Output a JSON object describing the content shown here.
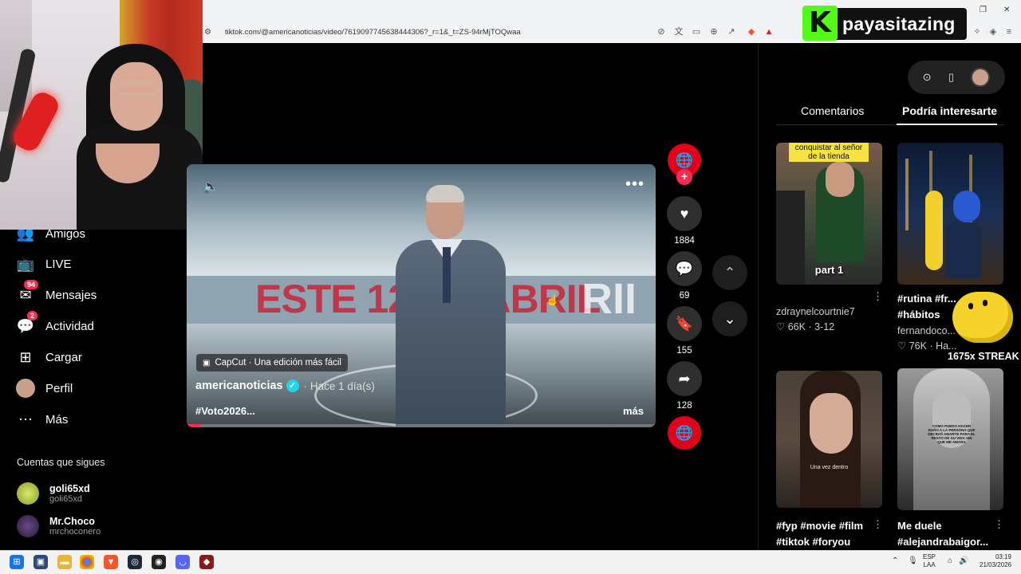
{
  "browser": {
    "url": "tiktok.com/@americanoticias/video/7619097745638444306?_r=1&_t=ZS-94rMjTOQwaa",
    "window_controls": [
      "–",
      "❐",
      "✕"
    ]
  },
  "streamer": {
    "logo_letter": "K",
    "name": "payasitazing",
    "brand_color": "#53fc18"
  },
  "sidebar": {
    "items": [
      {
        "label": "Amigos",
        "icon": "friends-icon"
      },
      {
        "label": "LIVE",
        "icon": "live-icon"
      },
      {
        "label": "Mensajes",
        "icon": "messages-icon",
        "badge": "94"
      },
      {
        "label": "Actividad",
        "icon": "activity-icon",
        "badge": "2"
      },
      {
        "label": "Cargar",
        "icon": "upload-icon"
      },
      {
        "label": "Perfil",
        "icon": "avatar"
      },
      {
        "label": "Más",
        "icon": "more-icon"
      }
    ],
    "following_title": "Cuentas que sigues",
    "following": [
      {
        "name": "goli65xd",
        "handle": "goli65xd"
      },
      {
        "name": "Mr.Choco",
        "handle": "mrchoconero"
      }
    ]
  },
  "video": {
    "overlay_text": "ESTE 12 DE ABRIL",
    "overlay_text2": "RII",
    "effect_label": "CapCut · Una edición más fácil",
    "author": "americanoticias",
    "time": "· Hace 1 día(s)",
    "hashtag": "#Voto2026...",
    "more_label": "más",
    "progress": 0.03
  },
  "actions": {
    "likes": "1884",
    "comments": "69",
    "saves": "155",
    "shares": "128"
  },
  "right_panel": {
    "tabs": [
      "Comentarios",
      "Podría interesarte"
    ],
    "active_tab": "Podría interesarte",
    "thumbs": [
      {
        "overlay_top": "conquistar al señor de la tienda",
        "overlay_bottom": "part 1",
        "user": "zdraynelcourtnie7",
        "likes": "66K",
        "date": "3-12"
      },
      {
        "caption": "#rutina #fr... #hábitos",
        "user": "fernandoco...",
        "likes": "76K",
        "date": "Ha..."
      },
      {
        "overlay_mid": "Una vez dentro",
        "caption": "#fyp #movie #film #tiktok #foryou"
      },
      {
        "overlay_top": "COMO PUEDO HACER DAÑO A LA PERSONA QUE DECIDIÓ AMARTE PARA EL RESTO DE SU VIDA SIN QUE ME AMARA",
        "caption": "Me duele #alejandrabaigor..."
      }
    ]
  },
  "streak": {
    "text": "1675x STREAK"
  },
  "taskbar": {
    "lang_line1": "ESP",
    "lang_line2": "LAA",
    "time": "03:19",
    "date": "21/03/2026"
  }
}
